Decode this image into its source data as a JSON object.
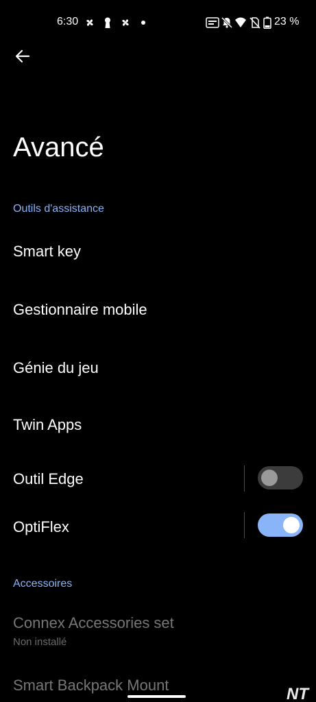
{
  "status_bar": {
    "time": "6:30",
    "battery": "23 %",
    "icons_left": [
      "pinwheel-icon",
      "keyhole-icon",
      "pinwheel-icon",
      "dot-icon"
    ],
    "icons_right": [
      "auto-hd-icon",
      "mute-icon",
      "wifi-icon",
      "no-sim-icon",
      "battery-icon"
    ]
  },
  "header": {
    "back_icon": "arrow-left-icon",
    "title": "Avancé"
  },
  "sections": {
    "tools": {
      "label": "Outils d'assistance",
      "items": {
        "smart_key": "Smart key",
        "mobile_manager": "Gestionnaire mobile",
        "game_genie": "Génie du jeu",
        "twin_apps": "Twin Apps",
        "edge_tool": "Outil Edge",
        "optiflex": "OptiFlex"
      },
      "toggles": {
        "edge_tool": false,
        "optiflex": true
      }
    },
    "accessories": {
      "label": "Accessoires",
      "items": {
        "connex": "Connex Accessories set",
        "connex_sub": "Non installé",
        "backpack": "Smart Backpack Mount"
      }
    }
  },
  "watermark": "NT",
  "colors": {
    "background": "#000000",
    "accent": "#8ab4f8",
    "disabled_text": "#777777"
  }
}
